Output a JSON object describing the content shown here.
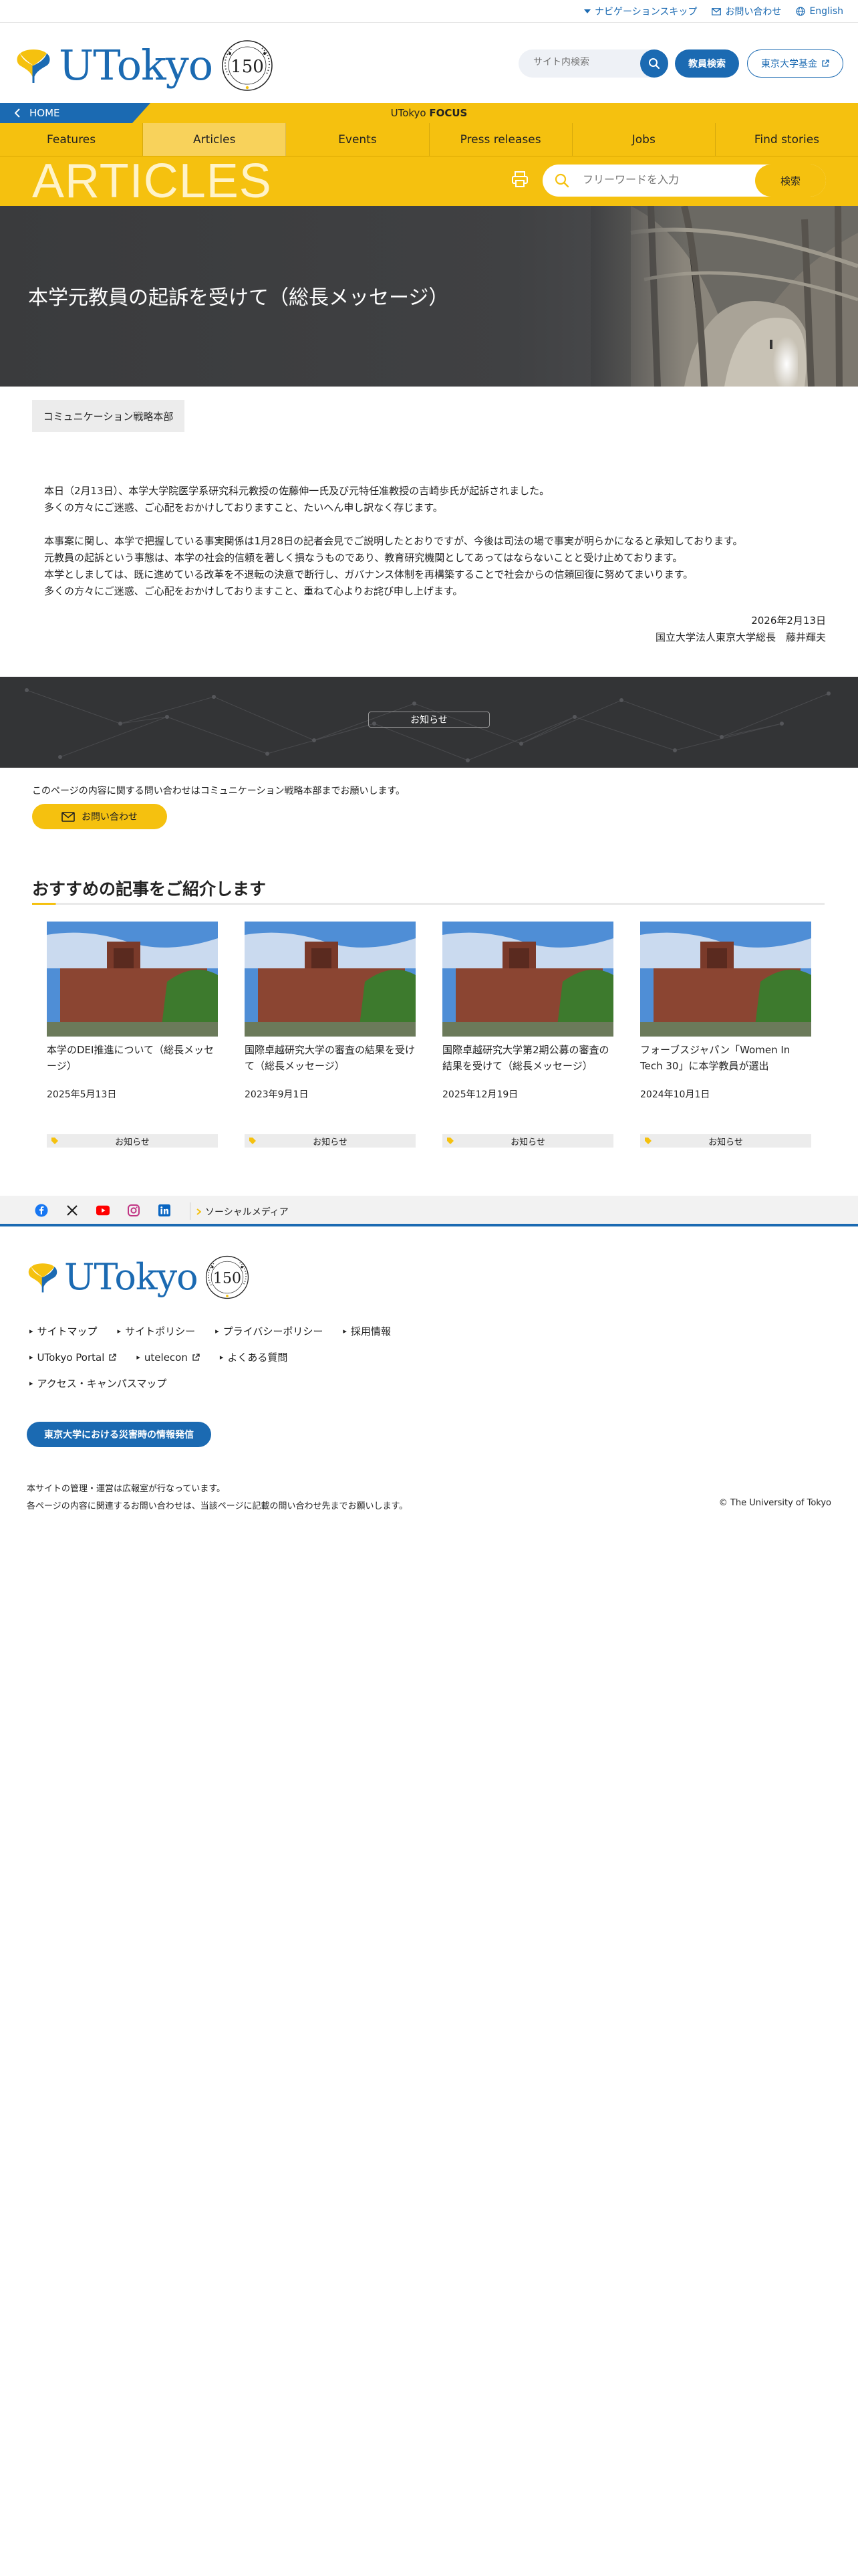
{
  "utility": {
    "skip_nav": "ナビゲーションスキップ",
    "contact": "お問い合わせ",
    "english": "English"
  },
  "header": {
    "logo_text": "UTokyo",
    "logo_150": "150",
    "search_placeholder": "サイト内検索",
    "staff_search": "教員検索",
    "fund": "東京大学基金"
  },
  "focus_bar": {
    "home": "HOME",
    "title_prefix": "UTokyo ",
    "title_strong": "FOCUS"
  },
  "nav": {
    "items": [
      "Features",
      "Articles",
      "Events",
      "Press releases",
      "Jobs",
      "Find stories"
    ],
    "active_index": 1
  },
  "articles_band": {
    "title": "ARTICLES",
    "keyword_placeholder": "フリーワードを入力",
    "search_button": "検索"
  },
  "hero": {
    "title": "本学元教員の起訴を受けて（総長メッセージ）"
  },
  "article": {
    "department": "コミュニケーション戦略本部",
    "paragraphs": [
      [
        "本日（2月13日）、本学大学院医学系研究科元教授の佐藤伸一氏及び元特任准教授の吉崎歩氏が起訴されました。",
        "多くの方々にご迷惑、ご心配をおかけしておりますこと、たいへん申し訳なく存じます。"
      ],
      [
        "本事案に関し、本学で把握している事実関係は1月28日の記者会見でご説明したとおりですが、今後は司法の場で事実が明らかになると承知しております。",
        "元教員の起訴という事態は、本学の社会的信頼を著しく損なうものであり、教育研究機関としてあってはならないことと受け止めております。",
        "本学としましては、既に進めている改革を不退転の決意で断行し、ガバナンス体制を再構築することで社会からの信頼回復に努めてまいります。",
        "多くの方々にご迷惑、ご心配をおかけしておりますこと、重ねて心よりお詫び申し上げます。"
      ]
    ],
    "date": "2026年2月13日",
    "signature": "国立大学法人東京大学総長　藤井輝夫",
    "category": "お知らせ"
  },
  "contact": {
    "note": "このページの内容に関する問い合わせはコミュニケーション戦略本部までお願いします。",
    "button": "お問い合わせ"
  },
  "recommended": {
    "heading": "おすすめの記事をご紹介します",
    "cards": [
      {
        "title": "本学のDEI推進について（総長メッセージ）",
        "date": "2025年5月13日",
        "category": "お知らせ"
      },
      {
        "title": "国際卓越研究大学の審査の結果を受けて（総長メッセージ）",
        "date": "2023年9月1日",
        "category": "お知らせ"
      },
      {
        "title": "国際卓越研究大学第2期公募の審査の結果を受けて（総長メッセージ）",
        "date": "2025年12月19日",
        "category": "お知らせ"
      },
      {
        "title": "フォーブスジャパン「Women In Tech 30」に本学教員が選出",
        "date": "2024年10月1日",
        "category": "お知らせ"
      }
    ]
  },
  "social": {
    "icons": [
      "facebook-icon",
      "x-icon",
      "youtube-icon",
      "instagram-icon",
      "linkedin-icon"
    ],
    "label": "ソーシャルメディア"
  },
  "footer": {
    "links_row1": [
      "サイトマップ",
      "サイトポリシー",
      "プライバシーポリシー",
      "採用情報"
    ],
    "links_row2": [
      "UTokyo Portal",
      "utelecon",
      "よくある質問"
    ],
    "links_row3": [
      "アクセス・キャンパスマップ"
    ],
    "disaster": "東京大学における災害時の情報発信",
    "note1": "本サイトの管理・運営は広報室が行なっています。",
    "note2": "各ページの内容に関連するお問い合わせは、当該ページに記載の問い合わせ先までお願いします。",
    "copyright": "© The University of Tokyo"
  },
  "colors": {
    "brand_blue": "#1b6ab2",
    "brand_yellow": "#f5c10f",
    "hero_dark": "#3a3b3d"
  }
}
